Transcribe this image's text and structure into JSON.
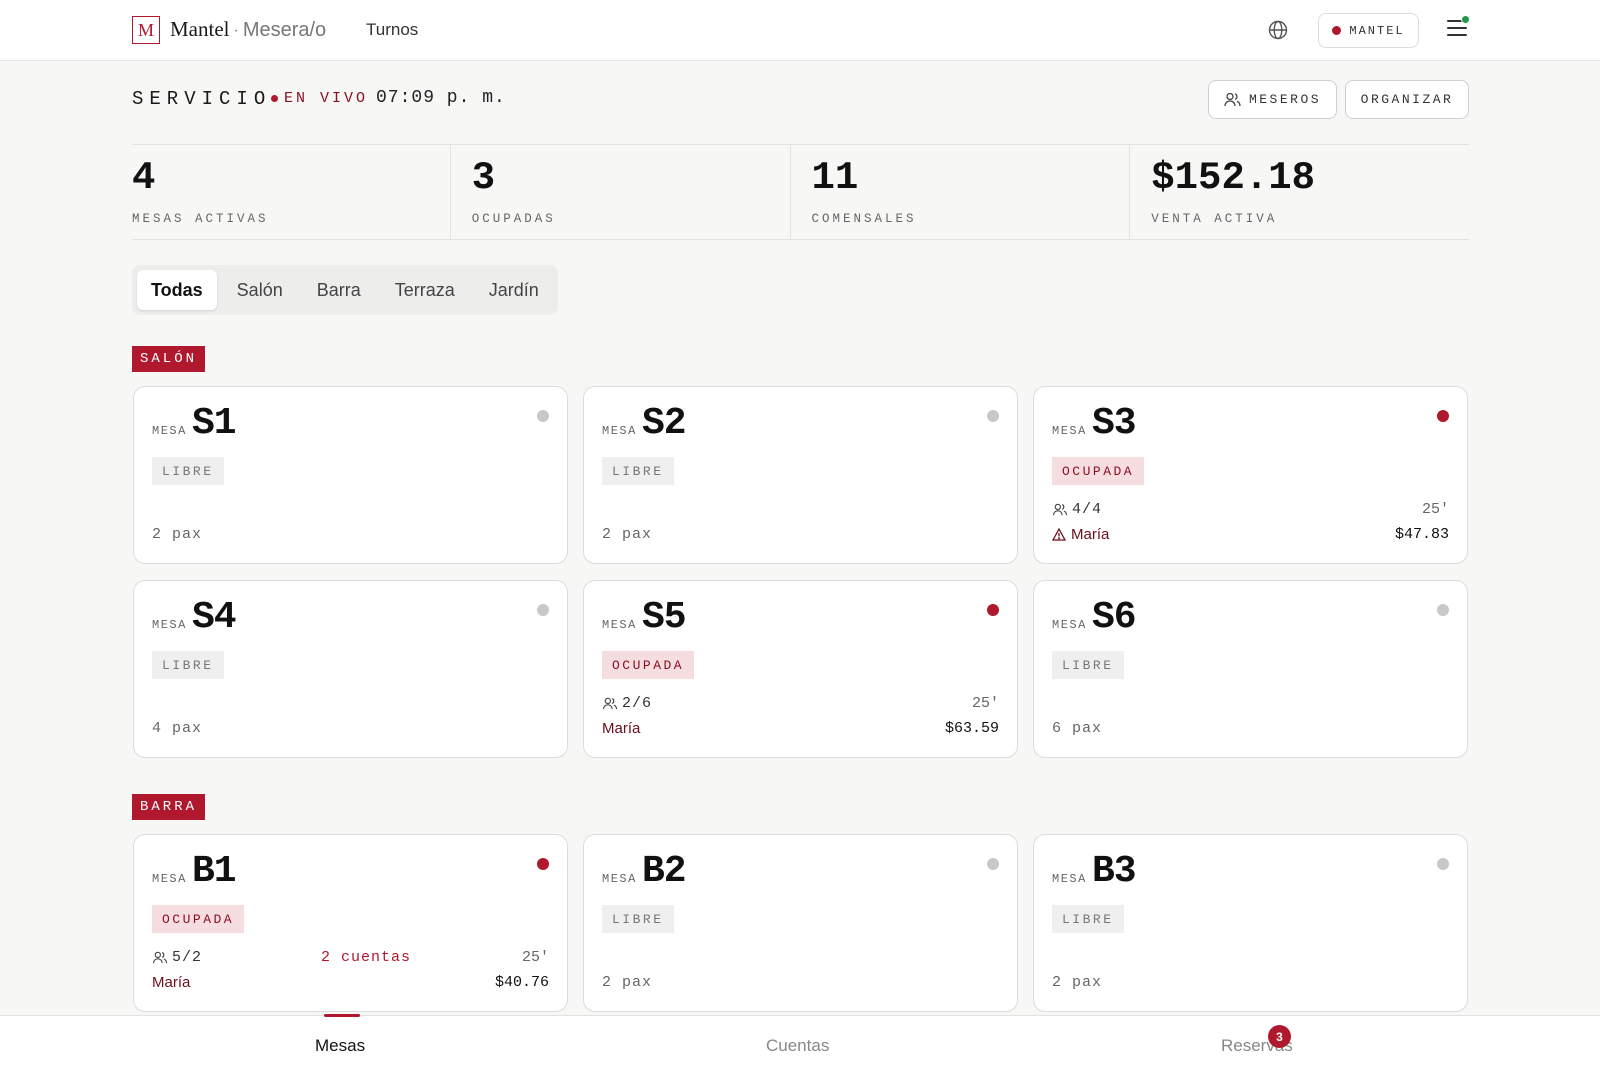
{
  "topbar": {
    "logo_letter": "M",
    "brand": "Mantel",
    "separator": "·",
    "role": "Mesera/o",
    "nav_turnos": "Turnos",
    "restaurant_button": "MANTEL",
    "globe_icon": "globe-icon",
    "menu_icon": "hamburger-menu-icon"
  },
  "service": {
    "title": "SERVICIO",
    "live_label": "EN VIVO",
    "time": "07:09 p. m.",
    "meseros_button": "MESEROS",
    "organizar_button": "ORGANIZAR"
  },
  "stats": [
    {
      "value": "4",
      "label": "MESAS ACTIVAS"
    },
    {
      "value": "3",
      "label": "OCUPADAS"
    },
    {
      "value": "11",
      "label": "COMENSALES"
    },
    {
      "value": "$152.18",
      "label": "VENTA ACTIVA"
    }
  ],
  "tabs": [
    {
      "label": "Todas",
      "active": true
    },
    {
      "label": "Salón",
      "active": false
    },
    {
      "label": "Barra",
      "active": false
    },
    {
      "label": "Terraza",
      "active": false
    },
    {
      "label": "Jardín",
      "active": false
    }
  ],
  "sections": {
    "salon": "SALÓN",
    "barra": "BARRA"
  },
  "mesa_label": "MESA",
  "tables": {
    "S1": {
      "id": "S1",
      "status": "LIBRE",
      "pax": "2 pax"
    },
    "S2": {
      "id": "S2",
      "status": "LIBRE",
      "pax": "2 pax"
    },
    "S3": {
      "id": "S3",
      "status": "OCUPADA",
      "occupancy": "4/4",
      "minutes": "25'",
      "waiter": "María",
      "amount": "$47.83"
    },
    "S4": {
      "id": "S4",
      "status": "LIBRE",
      "pax": "4 pax"
    },
    "S5": {
      "id": "S5",
      "status": "OCUPADA",
      "occupancy": "2/6",
      "minutes": "25'",
      "waiter": "María",
      "amount": "$63.59"
    },
    "S6": {
      "id": "S6",
      "status": "LIBRE",
      "pax": "6 pax"
    },
    "B1": {
      "id": "B1",
      "status": "OCUPADA",
      "occupancy": "5/2",
      "cuentas": "2 cuentas",
      "minutes": "25'",
      "waiter": "María",
      "amount": "$40.76"
    },
    "B2": {
      "id": "B2",
      "status": "LIBRE",
      "pax": "2 pax"
    },
    "B3": {
      "id": "B3",
      "status": "LIBRE",
      "pax": "2 pax"
    }
  },
  "bottom_nav": {
    "mesas": "Mesas",
    "cuentas": "Cuentas",
    "reservas": "Reservas",
    "reservas_badge": "3"
  },
  "colors": {
    "accent": "#b0182d",
    "live_text": "#8a1024",
    "waiter_text": "#6e0c1d",
    "online_dot": "#1f9a4a"
  }
}
